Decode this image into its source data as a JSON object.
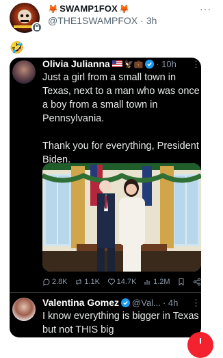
{
  "tweet": {
    "display_name": "SWAMP1FOX",
    "name_prefix_emoji": "🦊",
    "name_suffix_emoji": "🦊",
    "handle": "@THE1SWAMPFOX",
    "separator": "·",
    "time": "3h",
    "more": "···",
    "body_emoji": "🤣"
  },
  "quoted_post": {
    "author": "Olivia Julianna",
    "emojis": "🦅💼",
    "time": "· 10h",
    "more": "⋮",
    "text": "Just a girl from a small town in Texas, next to a man who was once a boy from a small town in Pennsylvania.\n\nThank you for everything, President Biden.",
    "metrics": {
      "replies": "2.8K",
      "reposts": "1.1K",
      "likes": "14.7K",
      "views": "1.2M"
    }
  },
  "reply": {
    "author": "Valentina Gomez",
    "handle": "@Val...",
    "time": "· 4h",
    "more": "⋮",
    "text": "I know everything is bigger in Texas but not THIS big"
  },
  "colors": {
    "verified": "#1d9bf0",
    "card_bg": "#000000",
    "fab": "#f4212e",
    "muted": "#536471"
  }
}
